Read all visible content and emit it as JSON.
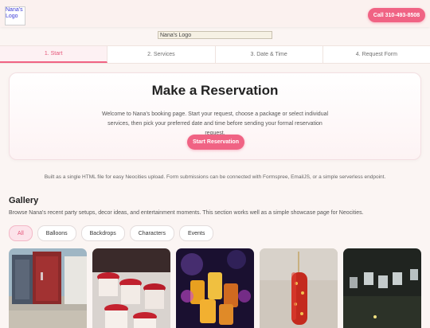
{
  "header": {
    "logo_alt": "Nana's Logo",
    "call_label": "Call 310-493-8508"
  },
  "main_logo_alt": "Nana's Logo",
  "steps": [
    {
      "label": "1. Start",
      "active": true
    },
    {
      "label": "2. Services",
      "active": false
    },
    {
      "label": "3. Date & Time",
      "active": false
    },
    {
      "label": "4. Request Form",
      "active": false
    }
  ],
  "hero": {
    "title": "Make a Reservation",
    "text": "Welcome to Nana's booking page. Start your request, choose a package or select individual services, then pick your preferred date and time before sending your formal reservation request.",
    "button": "Start Reservation"
  },
  "note": "Built as a single HTML file for easy Neocities upload. Form submissions can be connected with Formspree, EmailJS, or a simple serverless endpoint.",
  "gallery": {
    "title": "Gallery",
    "description": "Browse Nana's recent party setups, decor ideas, and entertainment moments. This section works well as a simple showcase page for Neocities.",
    "filters": [
      "All",
      "Balloons",
      "Backdrops",
      "Characters",
      "Events"
    ],
    "active_filter": "All",
    "photos": [
      "portable-restroom-photo",
      "dessert-cups-photo",
      "cocktail-drinks-photo",
      "corn-dog-snack-photo",
      "shot-glasses-photo"
    ]
  },
  "colors": {
    "accent": "#f06384",
    "background": "#fbf5f3"
  }
}
